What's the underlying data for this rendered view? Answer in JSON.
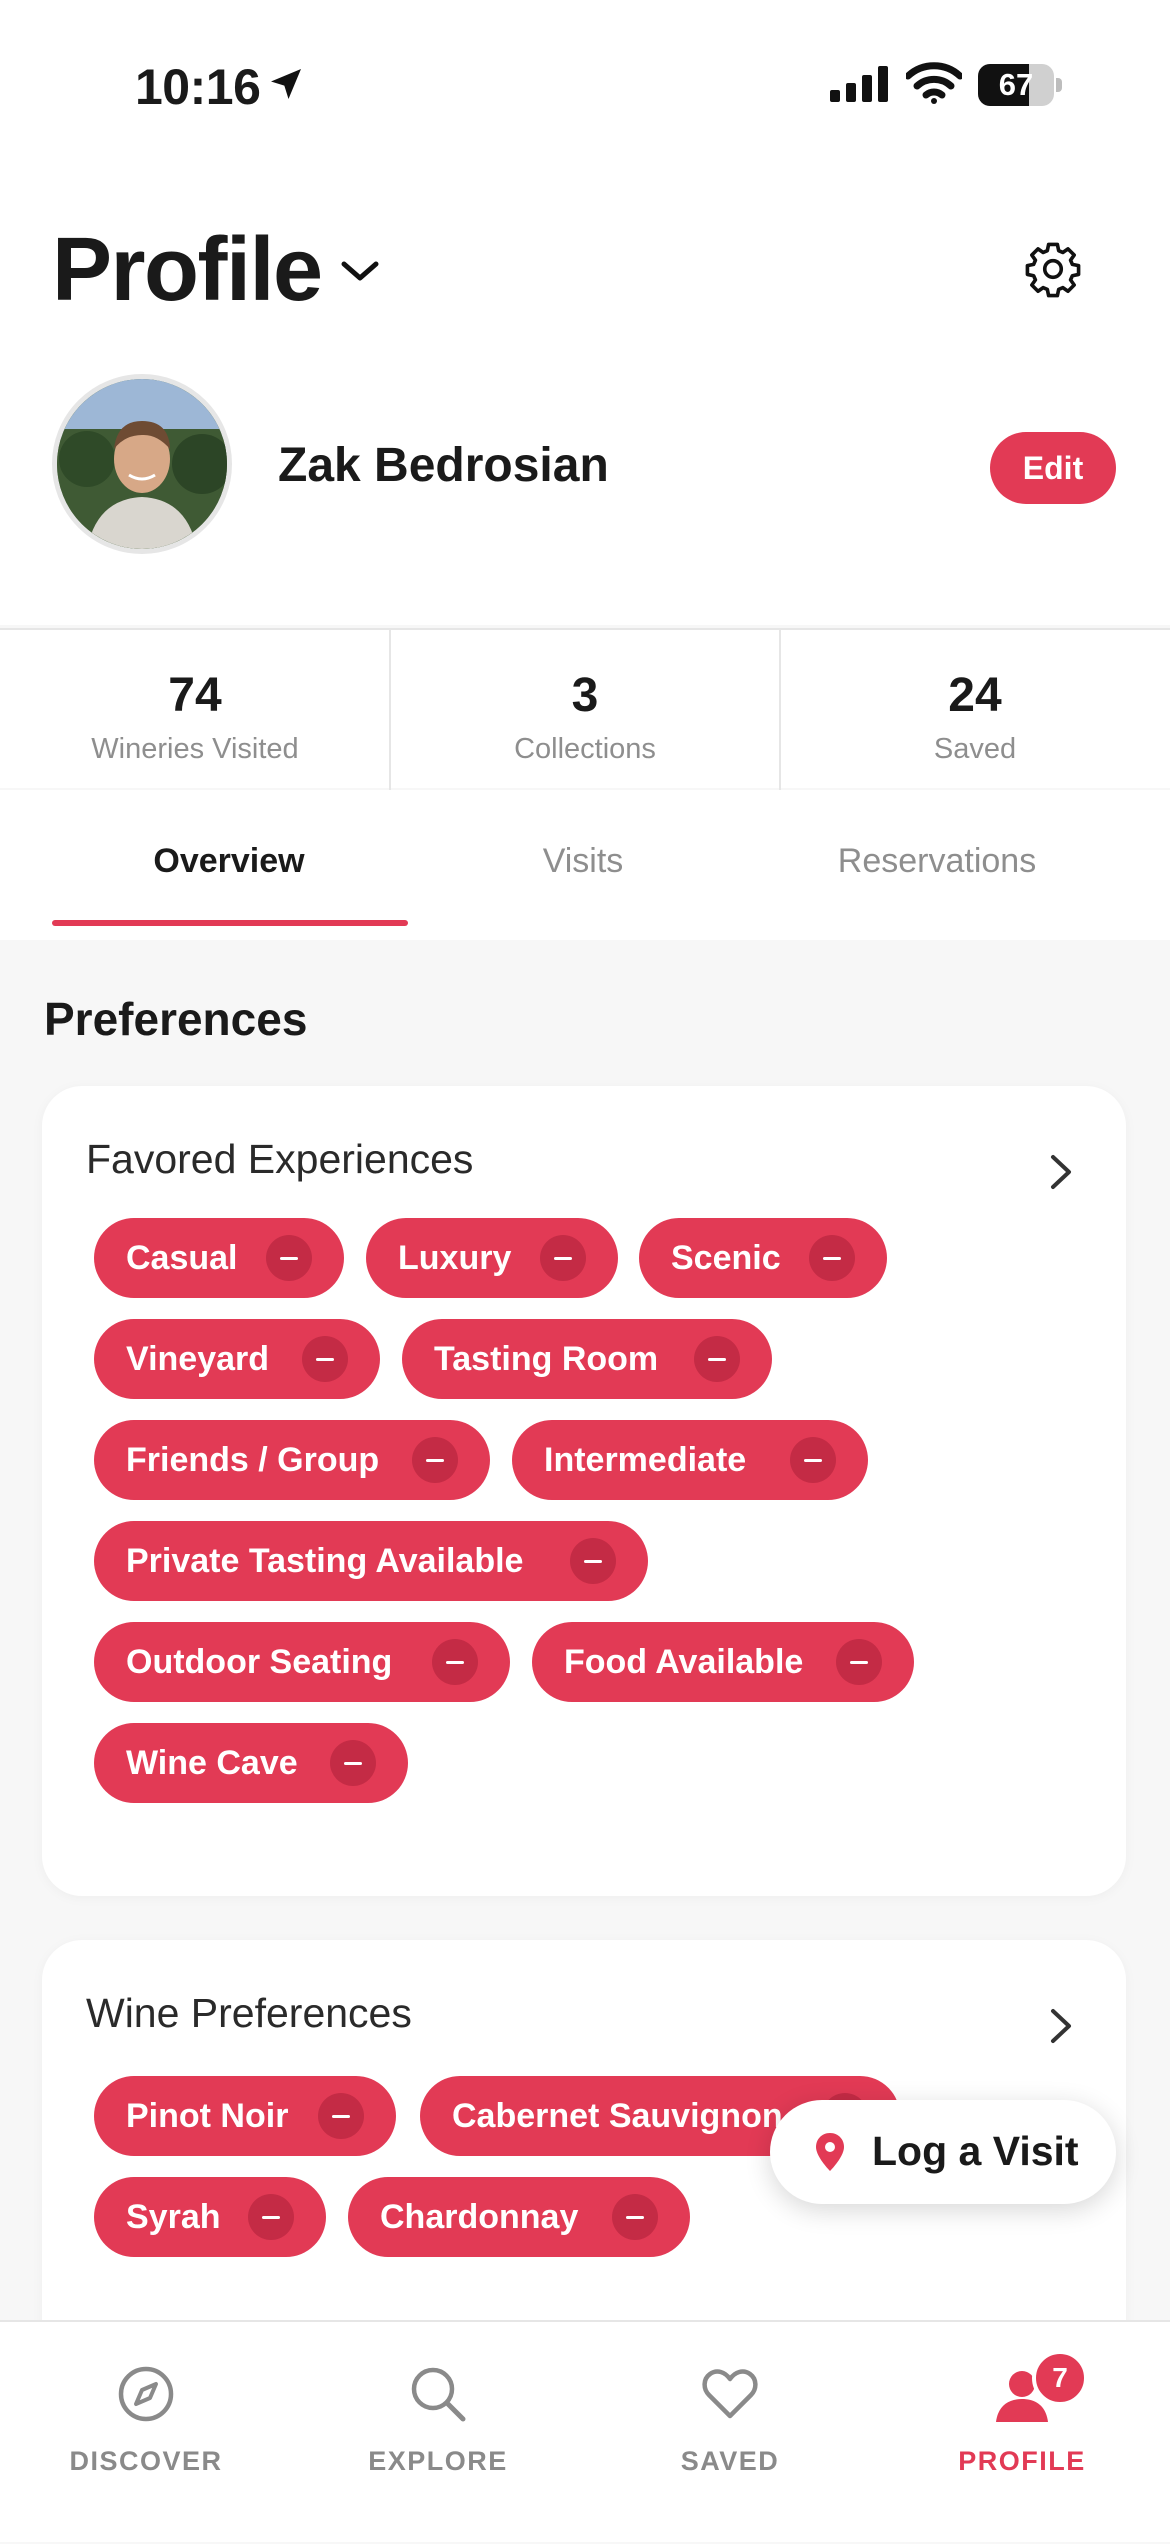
{
  "status_bar": {
    "time": "10:16",
    "battery": "67",
    "battery_level": 0.67
  },
  "header": {
    "title": "Profile"
  },
  "user": {
    "name": "Zak Bedrosian",
    "edit_label": "Edit"
  },
  "stats": [
    {
      "value": "74",
      "label": "Wineries Visited"
    },
    {
      "value": "3",
      "label": "Collections"
    },
    {
      "value": "24",
      "label": "Saved"
    }
  ],
  "tabs": [
    {
      "label": "Overview",
      "active": true
    },
    {
      "label": "Visits",
      "active": false
    },
    {
      "label": "Reservations",
      "active": false
    }
  ],
  "section_title": "Preferences",
  "favored_experiences": {
    "title": "Favored Experiences",
    "chips": [
      "Casual",
      "Luxury",
      "Scenic",
      "Vineyard",
      "Tasting Room",
      "Friends / Group",
      "Intermediate",
      "Private Tasting Available",
      "Outdoor Seating",
      "Food Available",
      "Wine Cave"
    ]
  },
  "wine_preferences": {
    "title": "Wine Preferences",
    "chips": [
      "Pinot Noir",
      "Cabernet Sauvignon",
      "Syrah",
      "Chardonnay"
    ]
  },
  "floating_button": {
    "label": "Log a Visit",
    "icon": "map-pin-icon"
  },
  "bottom_nav": [
    {
      "label": "DISCOVER",
      "icon": "compass-icon",
      "active": false
    },
    {
      "label": "EXPLORE",
      "icon": "search-icon",
      "active": false
    },
    {
      "label": "SAVED",
      "icon": "heart-icon",
      "active": false
    },
    {
      "label": "PROFILE",
      "icon": "user-icon",
      "active": true,
      "badge": "7"
    }
  ],
  "colors": {
    "accent": "#e23a55",
    "chip_minus": "#c42b45",
    "muted_text": "#8e8e8e"
  }
}
